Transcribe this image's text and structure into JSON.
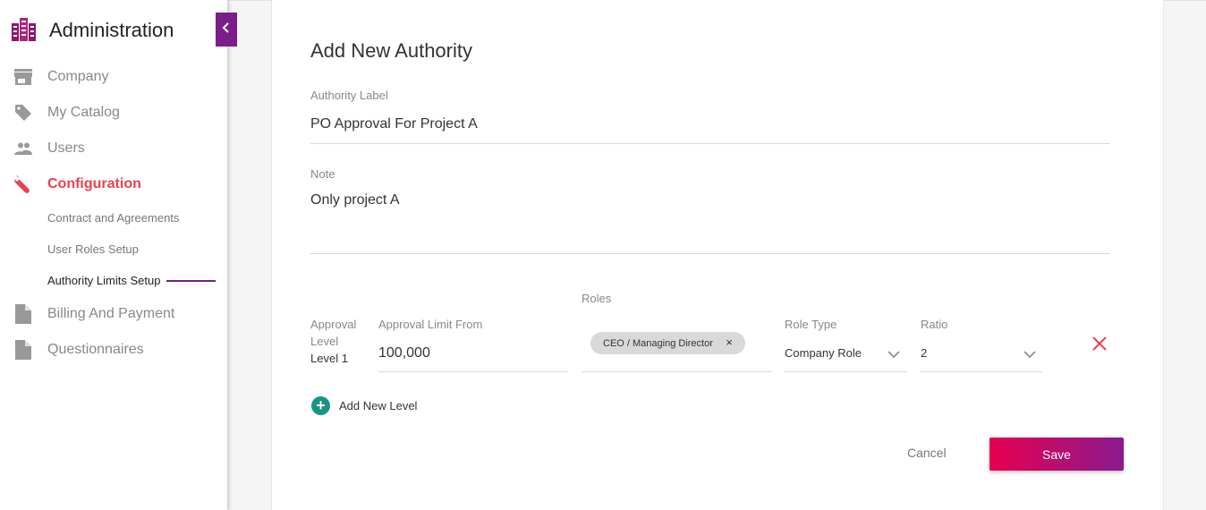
{
  "sidebar": {
    "title": "Administration",
    "items": [
      {
        "label": "Company",
        "icon": "store-icon"
      },
      {
        "label": "My Catalog",
        "icon": "tag-icon"
      },
      {
        "label": "Users",
        "icon": "users-icon"
      },
      {
        "label": "Configuration",
        "icon": "wrench-icon"
      },
      {
        "label": "Billing And Payment",
        "icon": "document-icon"
      },
      {
        "label": "Questionnaires",
        "icon": "document-icon"
      }
    ],
    "sub_items": [
      {
        "label": "Contract and Agreements"
      },
      {
        "label": "User Roles Setup"
      },
      {
        "label": "Authority Limits Setup"
      }
    ]
  },
  "form": {
    "title": "Add New Authority",
    "authority_label": {
      "label": "Authority Label",
      "value": "PO Approval For Project A"
    },
    "note": {
      "label": "Note",
      "value": "Only project A"
    },
    "level": {
      "approval_level_label_1": "Approval",
      "approval_level_label_2": "Level",
      "approval_level_value": "Level 1",
      "limit_label": "Approval Limit From",
      "limit_value": "100,000",
      "roles_label": "Roles",
      "role_chip": "CEO / Managing Director",
      "chip_remove": "×",
      "role_type_label": "Role Type",
      "role_type_value": "Company Role",
      "ratio_label": "Ratio",
      "ratio_value": "2"
    },
    "add_level": "Add New Level",
    "add_level_icon": "+",
    "cancel": "Cancel",
    "save": "Save"
  },
  "colors": {
    "accent": "#7b1e8a",
    "active": "#e8404d",
    "add": "#1a9384",
    "save_gradient_start": "#e8004f",
    "save_gradient_end": "#8a1a8e"
  }
}
